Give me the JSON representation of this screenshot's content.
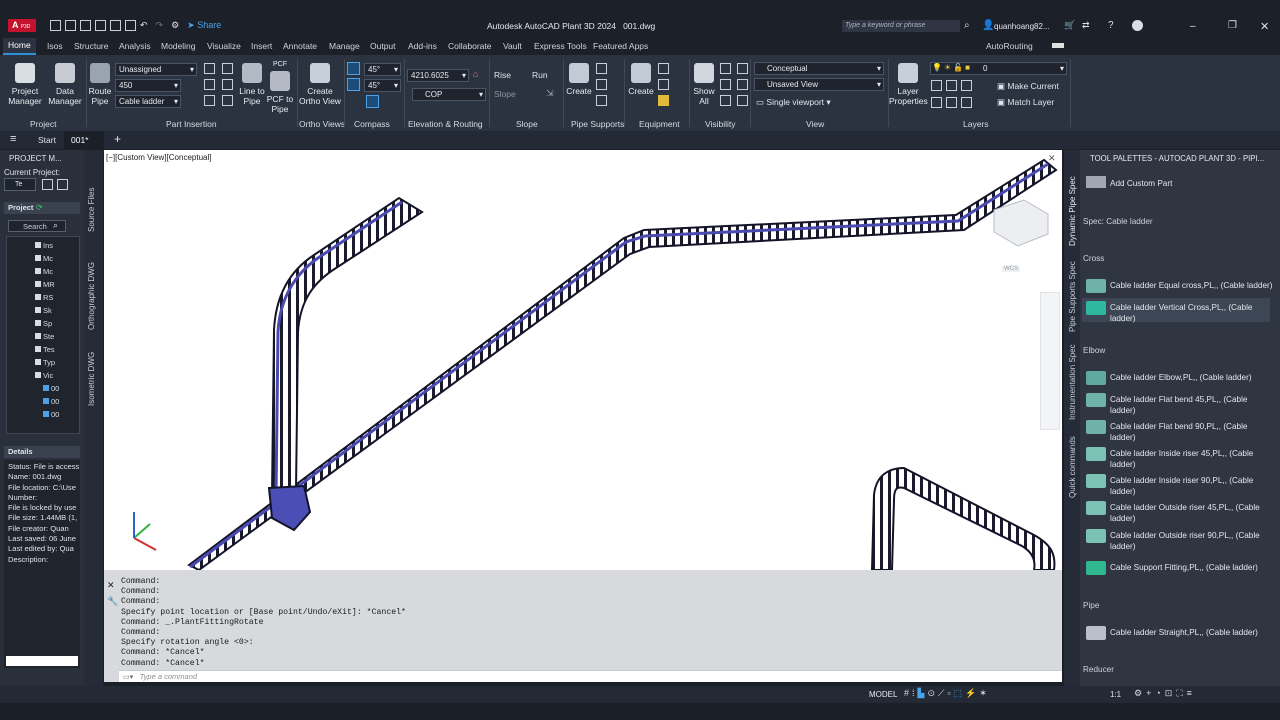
{
  "app": {
    "logo": "A",
    "logo_sub": "P3D",
    "share": "Share",
    "title": "Autodesk AutoCAD Plant 3D 2024   001.dwg",
    "search_placeholder": "Type a keyword or phrase",
    "user": "quanhoang82..."
  },
  "tabs": [
    "Home",
    "Isos",
    "Structure",
    "Analysis",
    "Modeling",
    "Visualize",
    "Insert",
    "Annotate",
    "Manage",
    "Output",
    "Add-ins",
    "Collaborate",
    "Vault",
    "Express Tools",
    "Featured Apps",
    "AutoRouting"
  ],
  "ribbon": {
    "project": {
      "manager": "Project\nManager",
      "data": "Data\nManager",
      "group": "Project"
    },
    "part_insertion": {
      "route_pipe": "Route\nPipe",
      "dd1": "Unassigned",
      "dd2": "450",
      "dd3": "Cable ladder",
      "line_to_pipe": "Line to\nPipe",
      "pcf": "PCF to\nPipe",
      "pcf_top": "PCF",
      "group": "Part Insertion"
    },
    "ortho": {
      "create": "Create\nOrtho View",
      "group": "Ortho Views"
    },
    "compass": {
      "a1": "45°",
      "a2": "45°",
      "group": "Compass"
    },
    "elevation": {
      "value": "4210.6025",
      "cop": "COP",
      "group": "Elevation & Routing"
    },
    "slope": {
      "rise": "Rise",
      "run": "Run",
      "slope": "Slope",
      "group": "Slope"
    },
    "pipe_supports": {
      "create": "Create",
      "group": "Pipe Supports"
    },
    "equipment": {
      "create": "Create",
      "group": "Equipment"
    },
    "visibility": {
      "show": "Show\nAll",
      "group": "Visibility"
    },
    "view": {
      "style": "Conceptual",
      "saved": "Unsaved View",
      "single": "Single viewport",
      "group": "View"
    },
    "layers": {
      "props": "Layer\nProperties",
      "layer": "0",
      "make_current": "Make Current",
      "match": "Match Layer",
      "group": "Layers"
    }
  },
  "doctabs": {
    "start": "Start",
    "file": "001*"
  },
  "viewport": {
    "label": "[−][Custom View][Conceptual]",
    "wcs": "WCS"
  },
  "left": {
    "title": "PROJECT M...",
    "current_project": "Current Project:",
    "te": "Te",
    "project": "Project",
    "search": "Search",
    "tree": [
      "Ins",
      "Mc",
      "Mc",
      "MR",
      "RS",
      "Sk",
      "Sp",
      "Ste",
      "Tes",
      "Typ",
      "Vic",
      "00",
      "00",
      "00"
    ],
    "details_title": "Details",
    "details": [
      "Status: File is access",
      "Name: 001.dwg",
      "File location: C:\\Use",
      "Number:",
      "File is locked by use",
      "File size: 1.44MB (1,",
      "File creator: Quan",
      "Last saved: 06 June",
      "Last edited by: Qua",
      "Description:"
    ],
    "vtabs": [
      "Source Files",
      "Orthographic DWG",
      "Isometric DWG"
    ]
  },
  "cmd": {
    "lines": [
      "Command:",
      "Command:",
      "Command:",
      "Specify point location or [Base point/Undo/eXit]: *Cancel*",
      "Command: _.PlantFittingRotate",
      "Command:",
      "Specify rotation angle <0>:",
      "Command: *Cancel*",
      "Command: *Cancel*"
    ],
    "placeholder": "Type a command"
  },
  "palette": {
    "title": "TOOL PALETTES - AUTOCAD PLANT 3D - PIPI...",
    "add_custom": "Add Custom Part",
    "spec": "Spec: Cable ladder",
    "sections": {
      "cross": "Cross",
      "elbow": "Elbow",
      "pipe": "Pipe",
      "reducer": "Reducer"
    },
    "cross_items": [
      "Cable ladder Equal cross,PL,, (Cable ladder)",
      "Cable ladder Vertical Cross,PL,, (Cable ladder)"
    ],
    "elbow_items": [
      "Cable ladder Elbow,PL,, (Cable ladder)",
      "Cable ladder Flat bend 45,PL,, (Cable ladder)",
      "Cable ladder Flat bend 90,PL,, (Cable ladder)",
      "Cable ladder Inside riser 45,PL,, (Cable ladder)",
      "Cable ladder Inside riser 90,PL,, (Cable ladder)",
      "Cable ladder Outside riser 45,PL,, (Cable ladder)",
      "Cable ladder Outside riser 90,PL,, (Cable ladder)",
      "Cable Support Fitting,PL,, (Cable ladder)"
    ],
    "pipe_items": [
      "Cable ladder Straight,PL,, (Cable ladder)"
    ],
    "vtabs": [
      "Dynamic Pipe Spec",
      "Pipe Supports Spec",
      "Instrumentation Spec",
      "Quick commands"
    ]
  },
  "status": {
    "model": "MODEL",
    "scale": "1:1"
  }
}
